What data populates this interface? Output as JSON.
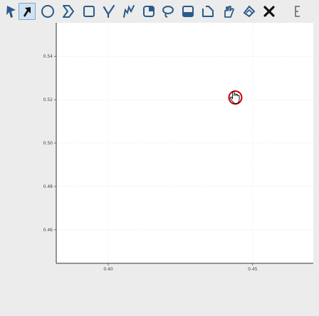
{
  "toolbar": {
    "tools": [
      {
        "name": "pointer-tool",
        "icon": "arrow-cursor-icon"
      },
      {
        "name": "pointer-select-tool",
        "icon": "arrow-pointer-active-icon",
        "active": true
      },
      {
        "name": "ellipse-tool",
        "icon": "circle-icon"
      },
      {
        "name": "polygon-tool",
        "icon": "polygon-icon"
      },
      {
        "name": "rectangle-tool",
        "icon": "rectangle-icon"
      },
      {
        "name": "check-tool",
        "icon": "checkmark-icon"
      },
      {
        "name": "freehand-tool",
        "icon": "freehand-icon"
      },
      {
        "name": "region-tool",
        "icon": "region-fill-icon"
      },
      {
        "name": "lasso-tool",
        "icon": "lasso-icon"
      },
      {
        "name": "layer-tool",
        "icon": "layer-fill-icon"
      },
      {
        "name": "polyline-tool",
        "icon": "polyline-icon"
      },
      {
        "name": "pan-tool",
        "icon": "hand-icon"
      },
      {
        "name": "paint-tool",
        "icon": "paint-bucket-icon"
      },
      {
        "name": "delete-tool",
        "icon": "x-delete-icon"
      },
      {
        "name": "extra-tool",
        "icon": "bracket-icon"
      }
    ]
  },
  "chart_data": {
    "type": "scatter",
    "title": "",
    "xlabel": "",
    "ylabel": "",
    "x_ticks": [
      "0.40",
      "0.45"
    ],
    "y_ticks": [
      "0.54",
      "0.52",
      "0.50",
      "0.48",
      "0.46"
    ],
    "xlim": [
      0.382,
      0.471
    ],
    "ylim": [
      0.4445,
      0.5555
    ],
    "grid": true,
    "points": [
      {
        "x": 0.444,
        "y": 0.521
      }
    ],
    "marker_color": "#cc0000",
    "cursor": {
      "icon": "hand-pointer-icon"
    }
  }
}
